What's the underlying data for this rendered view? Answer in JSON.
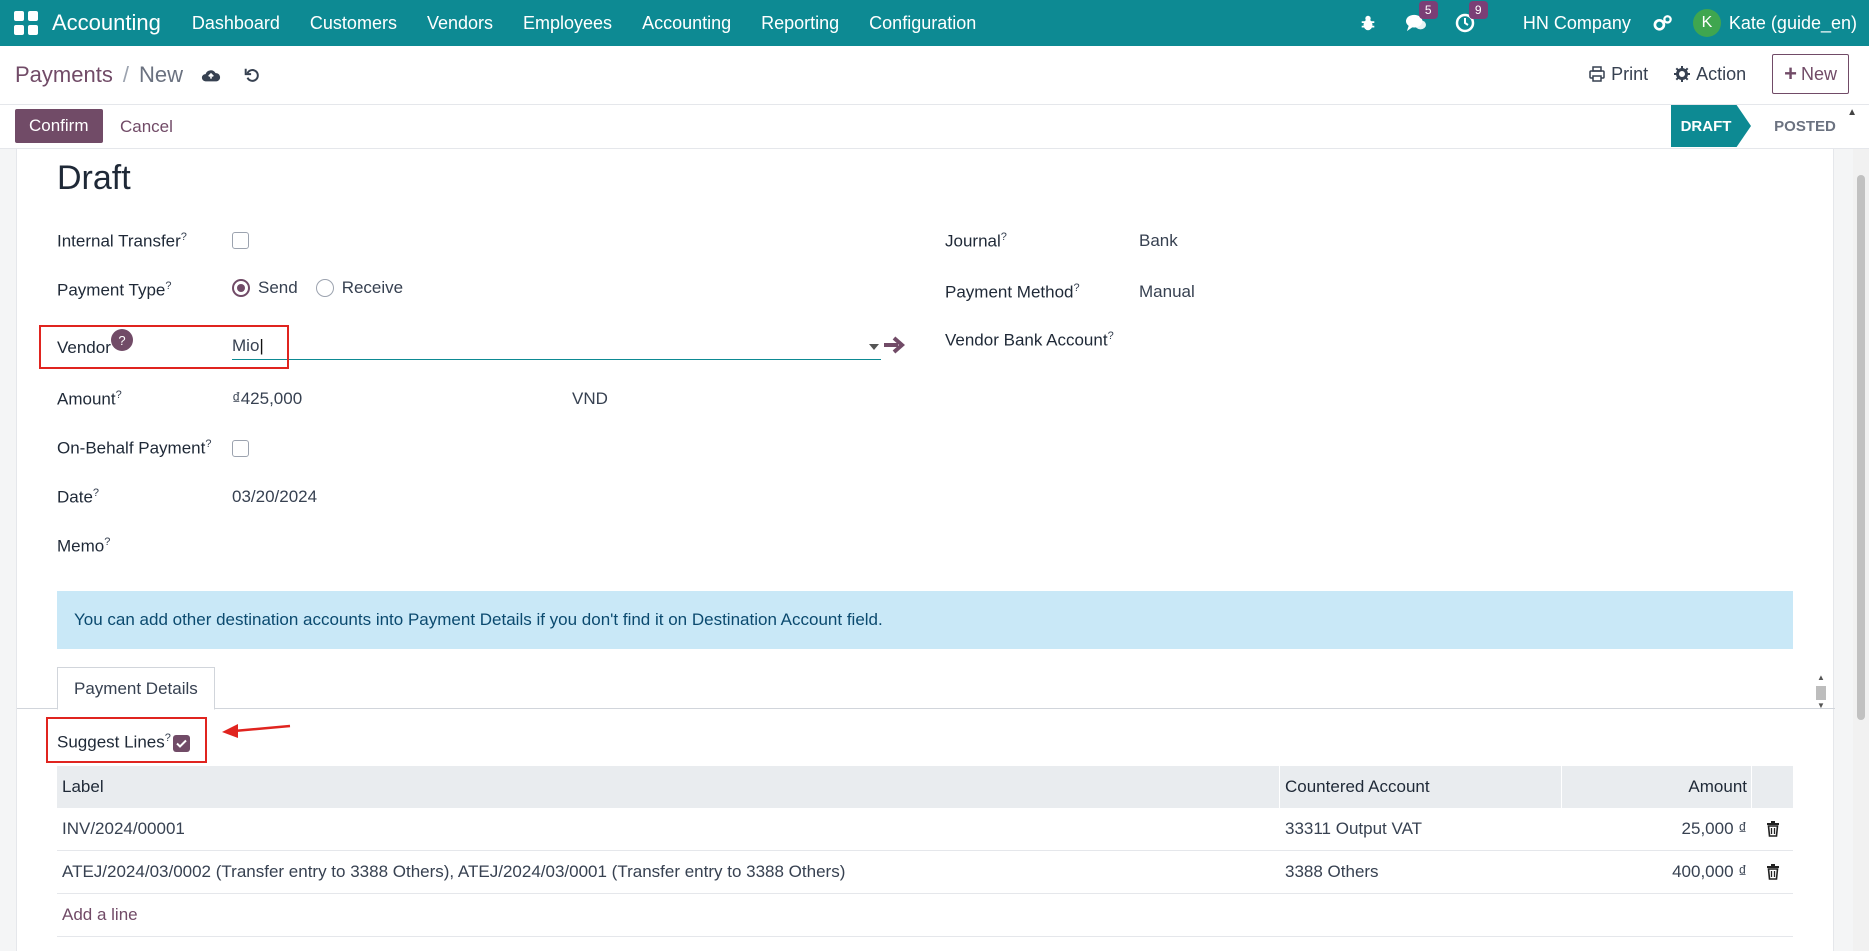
{
  "topbar": {
    "app_name": "Accounting",
    "menu": [
      "Dashboard",
      "Customers",
      "Vendors",
      "Employees",
      "Accounting",
      "Reporting",
      "Configuration"
    ],
    "messages_count": "5",
    "activities_count": "9",
    "company": "HN Company",
    "avatar_letter": "K",
    "user": "Kate (guide_en)"
  },
  "control": {
    "breadcrumb_parent": "Payments",
    "breadcrumb_current": "New",
    "print_label": "Print",
    "action_label": "Action",
    "new_label": "New"
  },
  "statusbar": {
    "confirm_label": "Confirm",
    "cancel_label": "Cancel",
    "stages": [
      "DRAFT",
      "POSTED"
    ]
  },
  "form": {
    "title": "Draft",
    "internal_transfer_label": "Internal Transfer",
    "payment_type_label": "Payment Type",
    "payment_type_options": [
      "Send",
      "Receive"
    ],
    "vendor_label": "Vendor",
    "vendor_value": "Mio",
    "amount_label": "Amount",
    "amount_value": "₫425,000",
    "currency": "VND",
    "on_behalf_label": "On-Behalf Payment",
    "date_label": "Date",
    "date_value": "03/20/2024",
    "memo_label": "Memo",
    "journal_label": "Journal",
    "journal_value": "Bank",
    "payment_method_label": "Payment Method",
    "payment_method_value": "Manual",
    "vendor_bank_label": "Vendor Bank Account",
    "help_mark": "?"
  },
  "alert": {
    "text": "You can add other destination accounts into Payment Details if you don't find it on Destination Account field."
  },
  "tabs": {
    "payment_details": "Payment Details"
  },
  "details": {
    "suggest_lines_label": "Suggest Lines",
    "columns": [
      "Label",
      "Countered Account",
      "Amount"
    ],
    "rows": [
      {
        "label": "INV/2024/00001",
        "account": "33311 Output VAT",
        "amount": "25,000 ₫"
      },
      {
        "label": "ATEJ/2024/03/0002 (Transfer entry to 3388 Others), ATEJ/2024/03/0001 (Transfer entry to 3388 Others)",
        "account": "3388 Others",
        "amount": "400,000 ₫"
      }
    ],
    "add_line": "Add a line"
  },
  "colors": {
    "primary": "#714b67",
    "teal": "#0d8a93",
    "highlight": "#e0241f"
  }
}
